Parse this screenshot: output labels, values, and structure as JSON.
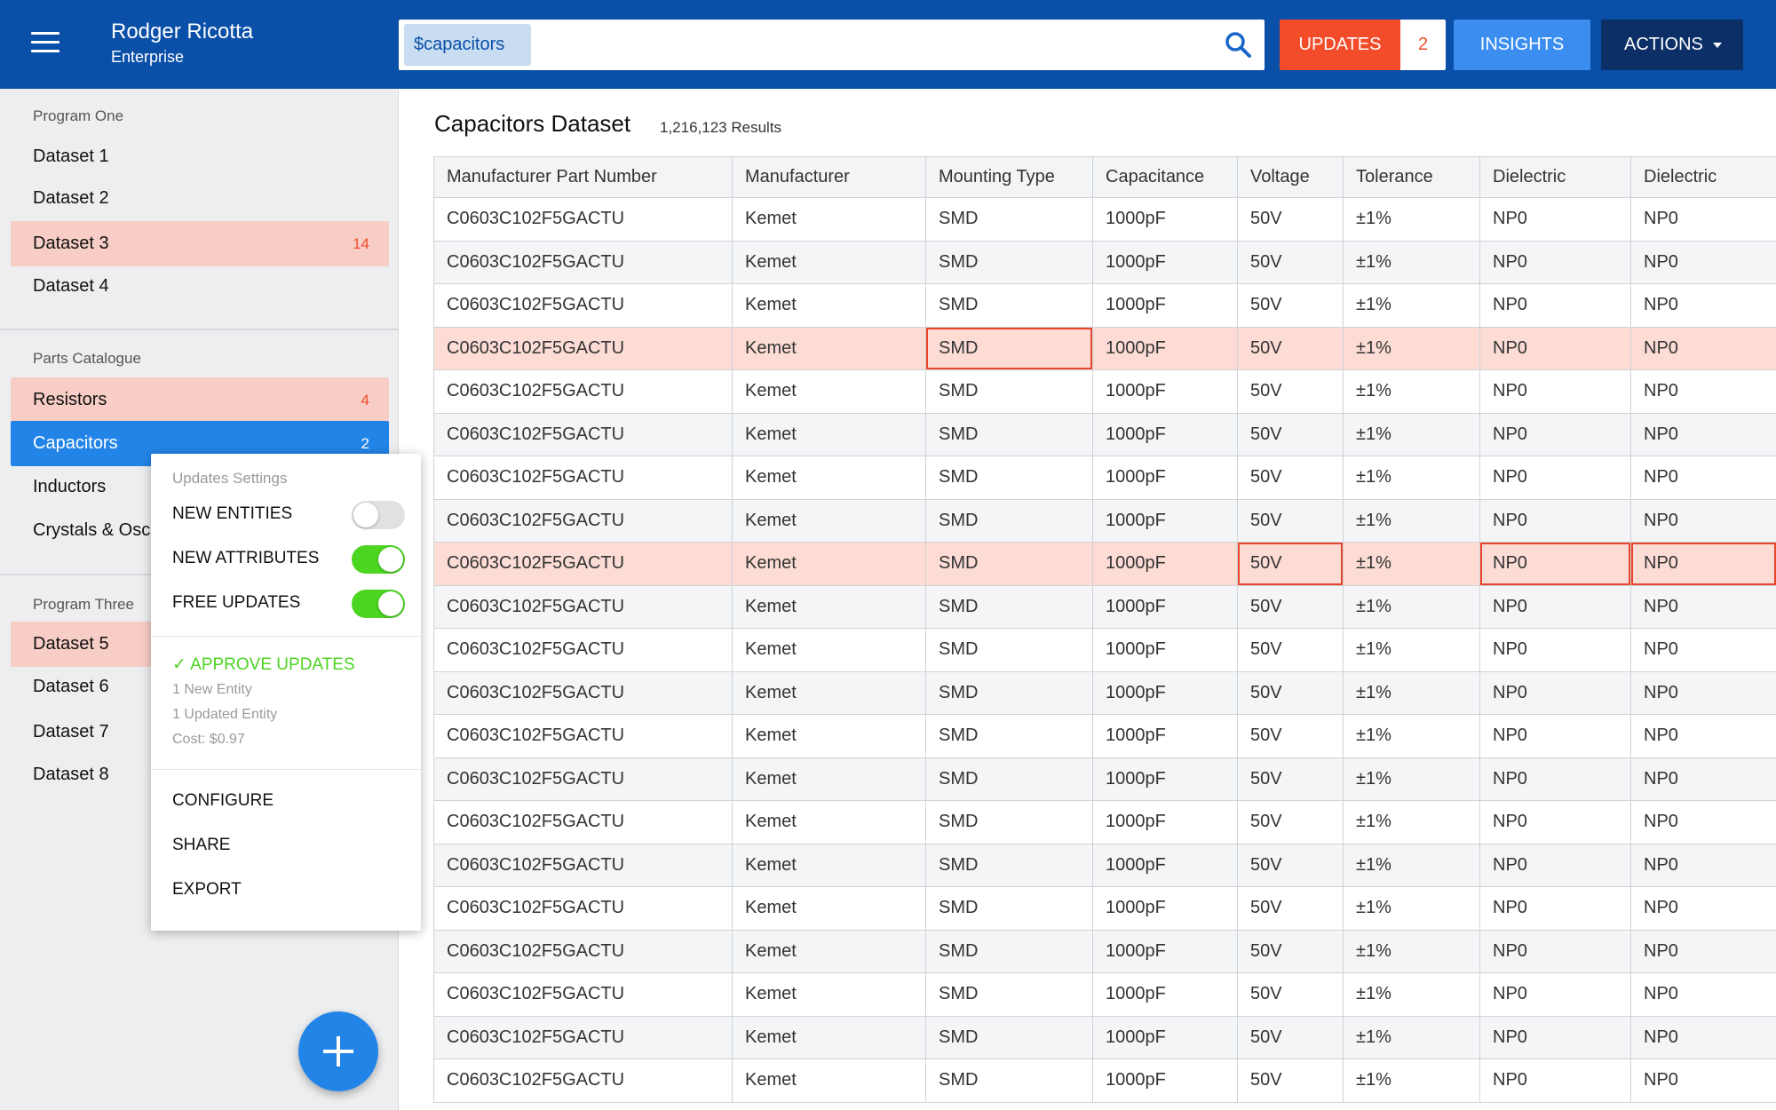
{
  "header": {
    "user_name": "Rodger Ricotta",
    "user_org": "Enterprise",
    "search_token": "$capacitors",
    "updates_label": "UPDATES",
    "updates_count": "2",
    "insights_label": "INSIGHTS",
    "actions_label": "ACTIONS",
    "icons": {
      "menu": "hamburger-icon",
      "search": "search-icon",
      "actions": "caret-down-icon"
    }
  },
  "sidebar": {
    "section1": {
      "title": "Program  One",
      "items": [
        {
          "label": "Dataset 1",
          "count": ""
        },
        {
          "label": "Dataset 2",
          "count": ""
        },
        {
          "label": "Dataset 3",
          "count": "14"
        },
        {
          "label": "Dataset 4",
          "count": ""
        }
      ]
    },
    "section2": {
      "title": "Parts Catalogue",
      "items": [
        {
          "label": "Resistors",
          "count": "4"
        },
        {
          "label": "Capacitors",
          "count": "2"
        },
        {
          "label": "Inductors",
          "count": ""
        },
        {
          "label": "Crystals & Osci",
          "count": ""
        }
      ]
    },
    "section3": {
      "title": "Program  Three",
      "items": [
        {
          "label": "Dataset 5",
          "count": ""
        },
        {
          "label": "Dataset 6",
          "count": ""
        },
        {
          "label": "Dataset 7",
          "count": ""
        },
        {
          "label": "Dataset 8",
          "count": ""
        }
      ]
    },
    "fab_icon": "plus-icon"
  },
  "popup": {
    "title": "Updates Settings",
    "toggles": [
      {
        "label": "NEW ENTITIES",
        "state": "off"
      },
      {
        "label": "NEW ATTRIBUTES",
        "state": "on"
      },
      {
        "label": "FREE UPDATES",
        "state": "on"
      }
    ],
    "approve_label": "✓ APPROVE UPDATES",
    "info_new": "1 New Entity",
    "info_updated": "1 Updated Entity",
    "info_cost": "Cost: $0.97",
    "menu": [
      "CONFIGURE",
      "SHARE",
      "EXPORT"
    ]
  },
  "main": {
    "title": "Capacitors Dataset",
    "result_count": "1,216,123 Results",
    "columns": [
      "Manufacturer Part Number",
      "Manufacturer",
      "Mounting Type",
      "Capacitance",
      "Voltage",
      "Tolerance",
      "Dielectric",
      "Dielectric"
    ],
    "rows": [
      {
        "cells": [
          "C0603C102F5GACTU",
          "Kemet",
          "SMD",
          "1000pF",
          "50V",
          "±1%",
          "NP0",
          "NP0"
        ],
        "alert": false,
        "flagged": []
      },
      {
        "cells": [
          "C0603C102F5GACTU",
          "Kemet",
          "SMD",
          "1000pF",
          "50V",
          "±1%",
          "NP0",
          "NP0"
        ],
        "alert": false,
        "flagged": []
      },
      {
        "cells": [
          "C0603C102F5GACTU",
          "Kemet",
          "SMD",
          "1000pF",
          "50V",
          "±1%",
          "NP0",
          "NP0"
        ],
        "alert": false,
        "flagged": []
      },
      {
        "cells": [
          "C0603C102F5GACTU",
          "Kemet",
          "SMD",
          "1000pF",
          "50V",
          "±1%",
          "NP0",
          "NP0"
        ],
        "alert": true,
        "flagged": [
          2
        ]
      },
      {
        "cells": [
          "C0603C102F5GACTU",
          "Kemet",
          "SMD",
          "1000pF",
          "50V",
          "±1%",
          "NP0",
          "NP0"
        ],
        "alert": false,
        "flagged": []
      },
      {
        "cells": [
          "C0603C102F5GACTU",
          "Kemet",
          "SMD",
          "1000pF",
          "50V",
          "±1%",
          "NP0",
          "NP0"
        ],
        "alert": false,
        "flagged": []
      },
      {
        "cells": [
          "C0603C102F5GACTU",
          "Kemet",
          "SMD",
          "1000pF",
          "50V",
          "±1%",
          "NP0",
          "NP0"
        ],
        "alert": false,
        "flagged": []
      },
      {
        "cells": [
          "C0603C102F5GACTU",
          "Kemet",
          "SMD",
          "1000pF",
          "50V",
          "±1%",
          "NP0",
          "NP0"
        ],
        "alert": false,
        "flagged": []
      },
      {
        "cells": [
          "C0603C102F5GACTU",
          "Kemet",
          "SMD",
          "1000pF",
          "50V",
          "±1%",
          "NP0",
          "NP0"
        ],
        "alert": true,
        "flagged": [
          4,
          6,
          7
        ]
      },
      {
        "cells": [
          "C0603C102F5GACTU",
          "Kemet",
          "SMD",
          "1000pF",
          "50V",
          "±1%",
          "NP0",
          "NP0"
        ],
        "alert": false,
        "flagged": []
      },
      {
        "cells": [
          "C0603C102F5GACTU",
          "Kemet",
          "SMD",
          "1000pF",
          "50V",
          "±1%",
          "NP0",
          "NP0"
        ],
        "alert": false,
        "flagged": []
      },
      {
        "cells": [
          "C0603C102F5GACTU",
          "Kemet",
          "SMD",
          "1000pF",
          "50V",
          "±1%",
          "NP0",
          "NP0"
        ],
        "alert": false,
        "flagged": []
      },
      {
        "cells": [
          "C0603C102F5GACTU",
          "Kemet",
          "SMD",
          "1000pF",
          "50V",
          "±1%",
          "NP0",
          "NP0"
        ],
        "alert": false,
        "flagged": []
      },
      {
        "cells": [
          "C0603C102F5GACTU",
          "Kemet",
          "SMD",
          "1000pF",
          "50V",
          "±1%",
          "NP0",
          "NP0"
        ],
        "alert": false,
        "flagged": []
      },
      {
        "cells": [
          "C0603C102F5GACTU",
          "Kemet",
          "SMD",
          "1000pF",
          "50V",
          "±1%",
          "NP0",
          "NP0"
        ],
        "alert": false,
        "flagged": []
      },
      {
        "cells": [
          "C0603C102F5GACTU",
          "Kemet",
          "SMD",
          "1000pF",
          "50V",
          "±1%",
          "NP0",
          "NP0"
        ],
        "alert": false,
        "flagged": []
      },
      {
        "cells": [
          "C0603C102F5GACTU",
          "Kemet",
          "SMD",
          "1000pF",
          "50V",
          "±1%",
          "NP0",
          "NP0"
        ],
        "alert": false,
        "flagged": []
      },
      {
        "cells": [
          "C0603C102F5GACTU",
          "Kemet",
          "SMD",
          "1000pF",
          "50V",
          "±1%",
          "NP0",
          "NP0"
        ],
        "alert": false,
        "flagged": []
      },
      {
        "cells": [
          "C0603C102F5GACTU",
          "Kemet",
          "SMD",
          "1000pF",
          "50V",
          "±1%",
          "NP0",
          "NP0"
        ],
        "alert": false,
        "flagged": []
      },
      {
        "cells": [
          "C0603C102F5GACTU",
          "Kemet",
          "SMD",
          "1000pF",
          "50V",
          "±1%",
          "NP0",
          "NP0"
        ],
        "alert": false,
        "flagged": []
      },
      {
        "cells": [
          "C0603C102F5GACTU",
          "Kemet",
          "SMD",
          "1000pF",
          "50V",
          "±1%",
          "NP0",
          "NP0"
        ],
        "alert": false,
        "flagged": []
      }
    ]
  },
  "colors": {
    "header_bg": "#0a4fa8",
    "updates": "#f24c2a",
    "insights": "#3b8ef0",
    "actions": "#0b2f66",
    "active_item": "#2384e8",
    "alert_bg": "#f7cdc6",
    "toggle_on": "#4cd521",
    "flag_border": "#e8452b"
  }
}
